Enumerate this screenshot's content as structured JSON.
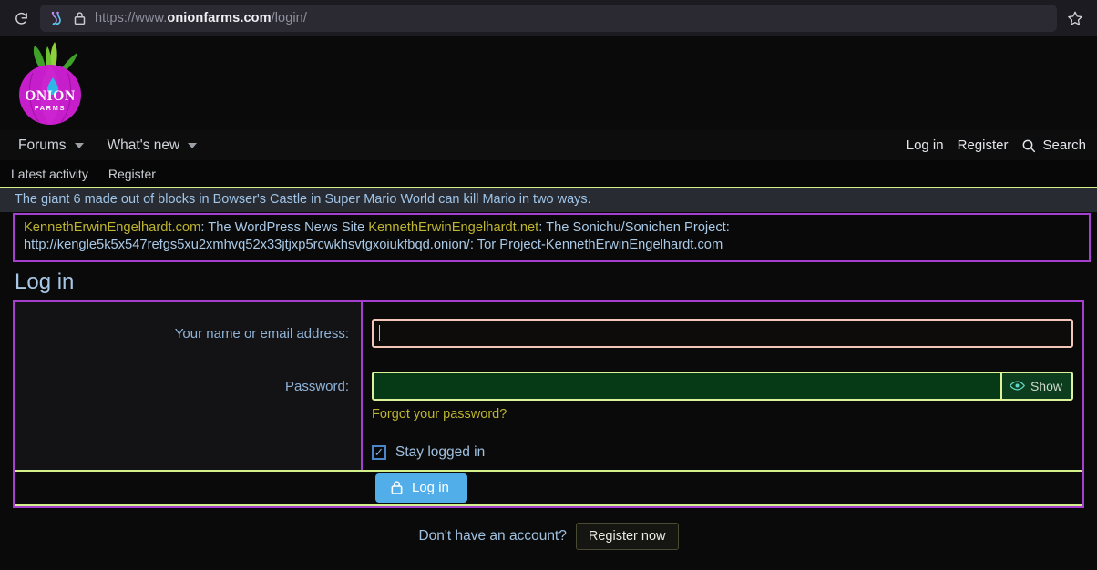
{
  "browser": {
    "reload_icon": "reload-icon",
    "tor_icon": "tor-circuit-icon",
    "lock_icon": "lock-icon",
    "url_prefix": "https://www.",
    "url_domain": "onionfarms.com",
    "url_path": "/login/",
    "bookmark_icon": "star-icon"
  },
  "site": {
    "logo_name": "ONION",
    "logo_sub": "FARMS"
  },
  "nav": {
    "forums": "Forums",
    "whats_new": "What's new",
    "login": "Log in",
    "register": "Register",
    "search": "Search",
    "search_icon": "search-icon"
  },
  "subnav": {
    "latest_activity": "Latest activity",
    "register": "Register"
  },
  "notice": {
    "text": "The giant 6 made out of blocks in Bowser's Castle in Super Mario World can kill Mario in two ways."
  },
  "signature_box": {
    "link1": "KennethErwinEngelhardt.com",
    "text1": ": The WordPress News Site ",
    "link2": "KennethErwinEngelhardt.net",
    "text2": ": The Sonichu/Sonichen Project:",
    "link3": "http://kengle5k5x547refgs5xu2xmhvq52x33jtjxp5rcwkhsvtgxoiukfbqd.onion/",
    "text3": ": Tor Project-KennethErwinEngelhardt.com"
  },
  "login": {
    "title": "Log in",
    "name_label": "Your name or email address:",
    "name_value": "",
    "password_label": "Password:",
    "password_value": "",
    "show_label": "Show",
    "show_icon": "eye-icon",
    "forgot_link": "Forgot your password?",
    "stay_logged_in": "Stay logged in",
    "stay_logged_in_checked": true,
    "check_glyph": "✓",
    "submit_label": "Log in",
    "submit_icon": "lock-icon",
    "no_account_text": "Don't have an account?",
    "register_now": "Register now"
  },
  "colors": {
    "accent_purple": "#a53fd0",
    "accent_green": "#d4f08a",
    "accent_blue": "#51aee8",
    "link_blue": "#a9c9e6",
    "link_olive": "#bdb430",
    "password_bg": "#063a17"
  }
}
